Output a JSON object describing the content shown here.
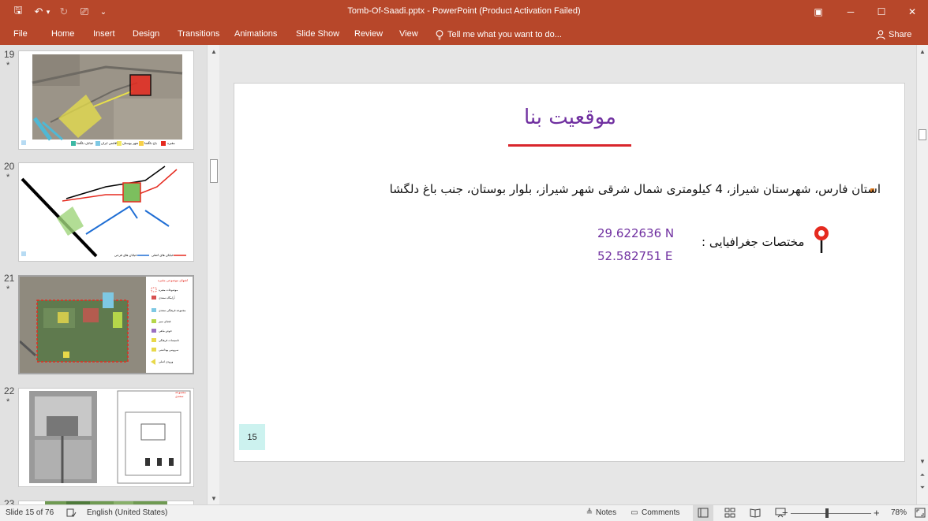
{
  "window": {
    "title": "Tomb-Of-Saadi.pptx  -  PowerPoint (Product Activation Failed)",
    "controls": {
      "ribbon_display": "▣",
      "minimize": "─",
      "maximize": "☐",
      "close": "✕"
    }
  },
  "quick_access": {
    "save": "🖫",
    "undo": "↶",
    "undo_dropdown": "▾",
    "redo": "↻",
    "slideshow": "⎚",
    "customize": "⌄"
  },
  "ribbon_tabs": [
    "File",
    "Home",
    "Insert",
    "Design",
    "Transitions",
    "Animations",
    "Slide Show",
    "Review",
    "View"
  ],
  "tell_me": {
    "icon": "lightbulb-icon",
    "placeholder": "Tell me what you want to do..."
  },
  "share": {
    "label": "Share",
    "icon": "person-icon"
  },
  "thumbnails": [
    {
      "number": "19",
      "star": "*",
      "legend": [
        "مقبره",
        "باغ دلگشا",
        "شهر بوستان",
        "اقامتی ایران",
        "خیابان دلگشا"
      ]
    },
    {
      "number": "20",
      "star": "*",
      "legend": [
        "خیابان های اصلی",
        "خیابان های فرعی"
      ]
    },
    {
      "number": "21",
      "star": "*",
      "legend_title": "لغتهای موضوعی مقبره",
      "legend": [
        "موضوعات مقبره",
        "آرامگاه سعدی",
        "مجموعه فرهنگی سعدی",
        "فضای سبز",
        "حوض ماهی",
        "تاسیسات فرهنگی",
        "سرویس بهداشتی",
        "ورودی اصلی"
      ]
    },
    {
      "number": "22",
      "star": "*",
      "caption": "مجموعه سعدی"
    },
    {
      "number": "23",
      "star": ""
    }
  ],
  "slide": {
    "title": "موقعیت بنا",
    "bullet": "استان فارس، شهرستان شیراز، 4 کیلومتری شمال شرقی شهر شیراز، بلوار بوستان، جنب باغ دلگشا",
    "coord_n": "29.622636 N",
    "coord_e": "52.582751 E",
    "geo_label": "مختصات جغرافیایی :",
    "page_number": "15",
    "colors": {
      "title": "#7030a0",
      "underline": "#d9262c",
      "bullet": "#e07b1f",
      "number_box": "#ccf2ef"
    }
  },
  "status": {
    "slide_counter": "Slide 15 of 76",
    "language": "English (United States)",
    "notes": "Notes",
    "comments": "Comments",
    "zoom": "78%",
    "zoom_level_fraction": 0.45
  }
}
